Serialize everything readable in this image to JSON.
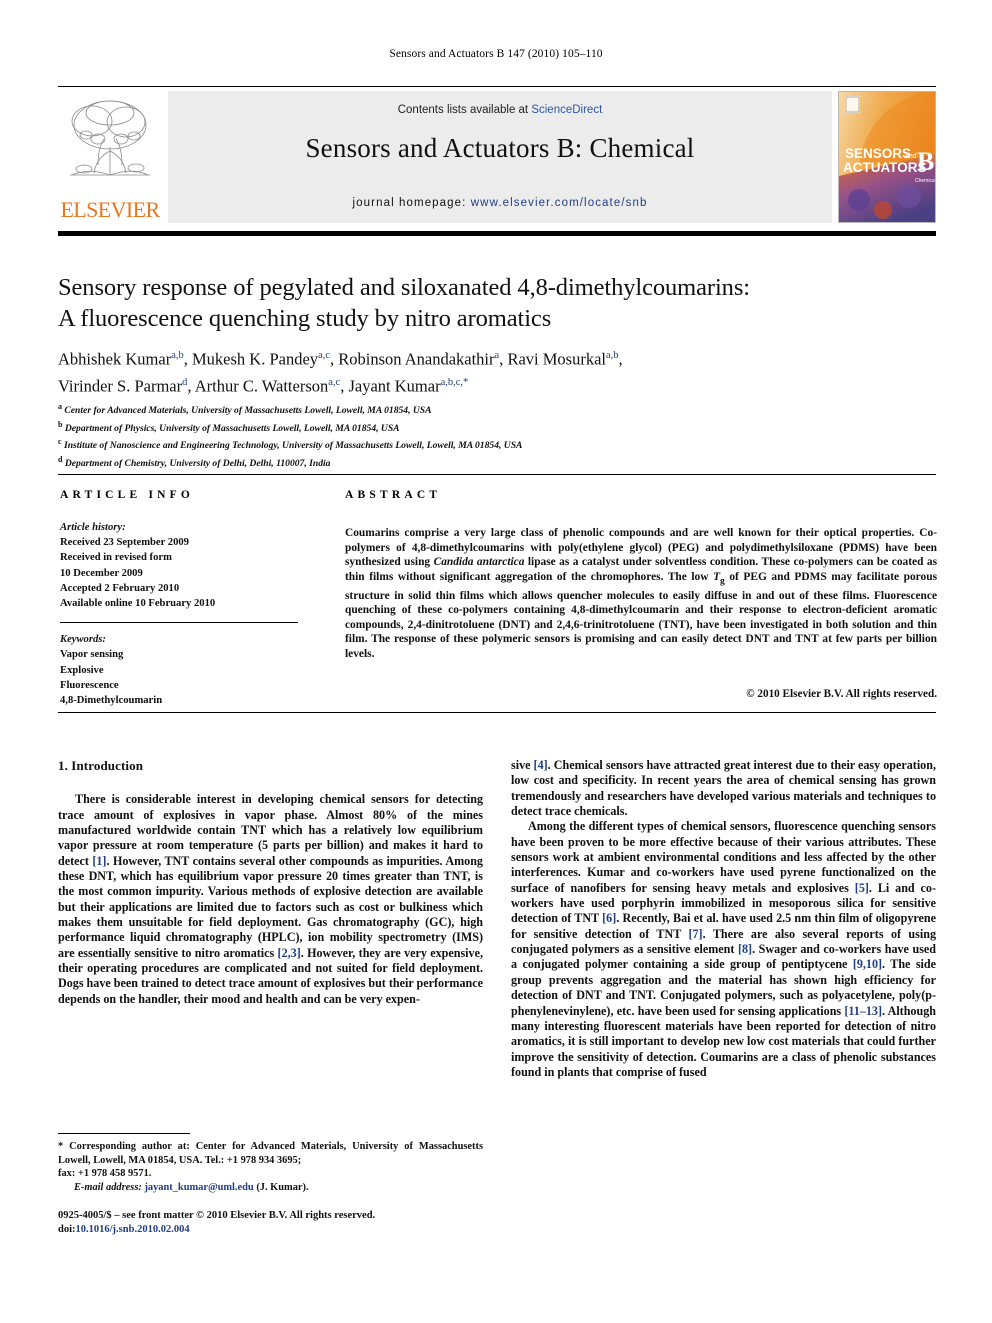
{
  "running_head": "Sensors and Actuators B 147 (2010) 105–110",
  "masthead": {
    "publisher_logo_text": "ELSEVIER",
    "contents_prefix": "Contents lists available at ",
    "contents_link": "ScienceDirect",
    "journal_title": "Sensors and Actuators B: Chemical",
    "homepage_prefix": "journal homepage: ",
    "homepage_url": "www.elsevier.com/locate/snb",
    "cover": {
      "line1": "SENSORS",
      "line1_suffix": "and",
      "line2": "ACTUATORS",
      "letter": "B",
      "sublabel": "Chemical"
    }
  },
  "article": {
    "title_line1": "Sensory response of pegylated and siloxanated 4,8-dimethylcoumarins:",
    "title_line2": "A fluorescence quenching study by nitro aromatics",
    "authors_line1": "Abhishek Kumar<sup>a,b</sup>, Mukesh K. Pandey<sup>a,c</sup>, Robinson Anandakathir<sup>a</sup>, Ravi Mosurkal<sup>a,b</sup>,",
    "authors_line2": "Virinder S. Parmar<sup>d</sup>, Arthur C. Watterson<sup>a,c</sup>, Jayant Kumar<sup>a,b,c,</sup><sup>*</sup>",
    "affiliations": [
      "<sup>a</sup> Center for Advanced Materials, University of Massachusetts Lowell, Lowell, MA 01854, USA",
      "<sup>b</sup> Department of Physics, University of Massachusetts Lowell, Lowell, MA 01854, USA",
      "<sup>c</sup> Institute of Nanoscience and Engineering Technology, University of Massachusetts Lowell, Lowell, MA 01854, USA",
      "<sup>d</sup> Department of Chemistry, University of Delhi, Delhi, 110007, India"
    ]
  },
  "sections": {
    "article_info_heading": "ARTICLE INFO",
    "abstract_heading": "ABSTRACT"
  },
  "article_info": {
    "history_label": "Article history:",
    "history_lines": [
      "Received 23 September 2009",
      "Received in revised form",
      "10 December 2009",
      "Accepted 2 February 2010",
      "Available online 10 February 2010"
    ],
    "keywords_label": "Keywords:",
    "keywords": [
      "Vapor sensing",
      "Explosive",
      "Fluorescence",
      "4,8-Dimethylcoumarin"
    ]
  },
  "abstract": {
    "html": "Coumarins comprise a very large class of phenolic compounds and are well known for their optical properties. Co-polymers of 4,8-dimethylcoumarins with poly(ethylene glycol) (PEG) and polydimethylsiloxane (PDMS) have been synthesized using <span class=\"it\">Candida antarctica</span> lipase as a catalyst under solventless condition. These co-polymers can be coated as thin films without significant aggregation of the chromophores. The low <span class=\"it\">T</span><sub>g</sub> of PEG and PDMS may facilitate porous structure in solid thin films which allows quencher molecules to easily diffuse in and out of these films. Fluorescence quenching of these co-polymers containing 4,8-dimethylcoumarin and their response to electron-deficient aromatic compounds, 2,4-dinitrotoluene (DNT) and 2,4,6-trinitrotoluene (TNT), have been investigated in both solution and thin film. The response of these polymeric sensors is promising and can easily detect DNT and TNT at few parts per billion levels.",
    "copyright": "© 2010 Elsevier B.V. All rights reserved."
  },
  "body": {
    "intro_heading": "1.  Introduction",
    "left_paragraphs": [
      "There is considerable interest in developing chemical sensors for detecting trace amount of explosives in vapor phase. Almost 80% of the mines manufactured worldwide contain TNT which has a relatively low equilibrium vapor pressure at room temperature (5 parts per billion) and makes it hard to detect <span class=\"ref\">[1]</span>. However, TNT contains several other compounds as impurities. Among these DNT, which has equilibrium vapor pressure 20 times greater than TNT, is the most common impurity. Various methods of explosive detection are available but their applications are limited due to factors such as cost or bulkiness which makes them unsuitable for field deployment. Gas chromatography (GC), high performance liquid chromatography (HPLC), ion mobility spectrometry (IMS) are essentially sensitive to nitro aromatics <span class=\"ref\">[2,3]</span>. However, they are very expensive, their operating procedures are complicated and not suited for field deployment. Dogs have been trained to detect trace amount of explosives but their performance depends on the handler, their mood and health and can be very expen-"
    ],
    "right_paragraphs": [
      "sive <span class=\"ref\">[4]</span>. Chemical sensors have attracted great interest due to their easy operation, low cost and specificity. In recent years the area of chemical sensing has grown tremendously and researchers have developed various materials and techniques to detect trace chemicals.",
      "Among the different types of chemical sensors, fluorescence quenching sensors have been proven to be more effective because of their various attributes. These sensors work at ambient environmental conditions and less affected by the other interferences. Kumar and co-workers have used pyrene functionalized on the surface of nanofibers for sensing heavy metals and explosives <span class=\"ref\">[5]</span>. Li and co-workers have used porphyrin immobilized in mesoporous silica for sensitive detection of TNT <span class=\"ref\">[6]</span>. Recently, Bai et al. have used 2.5 nm thin film of oligopyrene for sensitive detection of TNT <span class=\"ref\">[7]</span>. There are also several reports of using conjugated polymers as a sensitive element <span class=\"ref\">[8]</span>. Swager and co-workers have used a conjugated polymer containing a side group of pentiptycene <span class=\"ref\">[9,10]</span>. The side group prevents aggregation and the material has shown high efficiency for detection of DNT and TNT. Conjugated polymers, such as polyacetylene, poly(p-phenylenevinylene), etc. have been used for sensing applications <span class=\"ref\">[11–13]</span>. Although many interesting fluorescent materials have been reported for detection of nitro aromatics, it is still important to develop new low cost materials that could further improve the sensitivity of detection. Coumarins are a class of phenolic substances found in plants that comprise of fused"
    ]
  },
  "footnotes": {
    "corresponding_html": "* Corresponding author at: Center for Advanced Materials, University of Massachusetts Lowell, Lowell, MA 01854, USA. Tel.: +1 978 934 3695;",
    "fax_html": "fax: +1 978 458 9571.",
    "email_label": "E-mail address:",
    "email": "jayant_kumar@uml.edu",
    "email_attrib": "(J. Kumar)."
  },
  "footer": {
    "issn_line": "0925-4005/$ – see front matter © 2010 Elsevier B.V. All rights reserved.",
    "doi_prefix": "doi:",
    "doi": "10.1016/j.snb.2010.02.004"
  },
  "colors": {
    "elsevier_orange": "#E87722",
    "link_blue": "#1F3E87",
    "sciencedirect_blue": "#2B57A6",
    "band_gray": "#ECECEC"
  }
}
